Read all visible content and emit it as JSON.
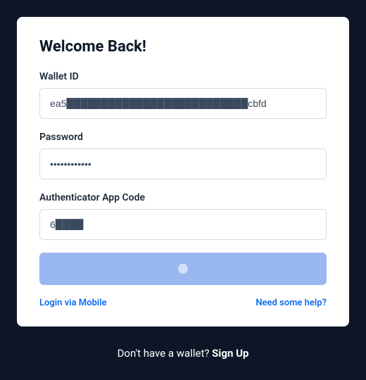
{
  "title": "Welcome Back!",
  "fields": {
    "walletId": {
      "label": "Wallet ID",
      "value": "ea5██████████████████████████cbfd"
    },
    "password": {
      "label": "Password",
      "value": "████████████"
    },
    "authCode": {
      "label": "Authenticator App Code",
      "value": "6████"
    }
  },
  "links": {
    "mobile": "Login via Mobile",
    "help": "Need some help?"
  },
  "footer": {
    "prompt": "Don't have a wallet? ",
    "action": "Sign Up"
  }
}
